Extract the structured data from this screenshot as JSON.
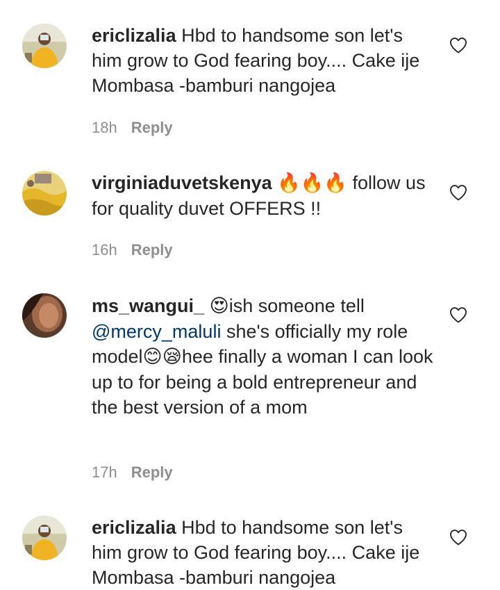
{
  "comments": [
    {
      "username": "ericlizalia",
      "text": "Hbd to handsome son let's him grow to God fearing boy.... Cake ije Mombasa -bamburi nangojea",
      "time": "18h",
      "reply_label": "Reply",
      "avatar_icon": "profile-photo-man-yellow-shirt"
    },
    {
      "username": "virginiaduvetskenya",
      "emojis": "🔥🔥🔥",
      "text": "follow us for quality duvet OFFERS !!",
      "time": "16h",
      "reply_label": "Reply",
      "avatar_icon": "profile-photo-yellow-duvet"
    },
    {
      "username": "ms_wangui_",
      "emoji_1": "😍",
      "text_1": "ish someone tell",
      "mention": "@mercy_maluli",
      "text_2": "she's officially my role model",
      "emoji_2": "😊😪",
      "text_3": "hee finally a woman I can look up to for being a bold entrepreneur and the best version of a mom",
      "time": "17h",
      "reply_label": "Reply",
      "avatar_icon": "profile-photo-woman"
    },
    {
      "username": "ericlizalia",
      "text": "Hbd to handsome son let's him grow to God fearing boy.... Cake ije Mombasa -bamburi nangojea",
      "avatar_icon": "profile-photo-man-yellow-shirt"
    }
  ],
  "icons": {
    "like": "heart-outline-icon"
  },
  "colors": {
    "text": "#262626",
    "meta": "#8e8e8e",
    "mention": "#00376b",
    "background": "#ffffff"
  }
}
